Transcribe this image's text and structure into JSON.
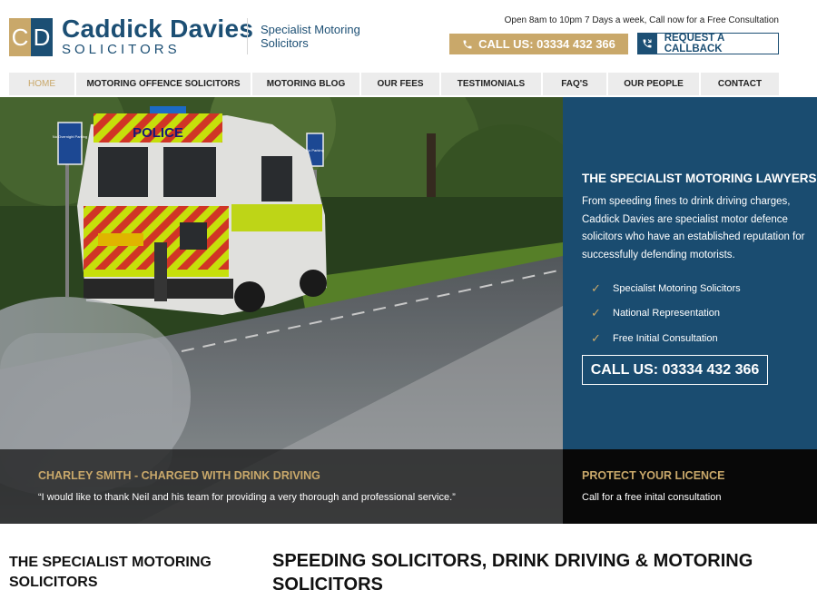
{
  "brand": {
    "logo_letters": [
      "C",
      "D"
    ],
    "name": "Caddick Davies",
    "sub": "SOLICITORS",
    "tagline": [
      "Specialist Motoring",
      "Solicitors"
    ]
  },
  "header": {
    "hours": "Open 8am to 10pm 7 Days a week, Call now for a Free Consultation",
    "call_label": "CALL US: 03334 432 366",
    "callback_label": "REQUEST A CALLBACK"
  },
  "nav": {
    "items": [
      {
        "label": "HOME",
        "active": true
      },
      {
        "label": "MOTORING OFFENCE SOLICITORS",
        "active": false
      },
      {
        "label": "MOTORING BLOG",
        "active": false
      },
      {
        "label": "OUR FEES",
        "active": false
      },
      {
        "label": "TESTIMONIALS",
        "active": false
      },
      {
        "label": "FAQ'S",
        "active": false
      },
      {
        "label": "OUR PEOPLE",
        "active": false
      },
      {
        "label": "CONTACT",
        "active": false
      }
    ]
  },
  "hero": {
    "photo": {
      "van_label": "POLICE",
      "sign_1": "No Overnight Parking",
      "sign_2": "No Parking"
    },
    "panel": {
      "title": "THE SPECIALIST MOTORING LAWYERS",
      "text": "From speeding fines to drink driving charges, Caddick Davies are specialist motor defence solicitors who have an established reputation for successfully defending motorists.",
      "list": [
        "Specialist Motoring Solicitors",
        "National Representation",
        "Free Initial Consultation"
      ],
      "call_label": "CALL US: 03334 432 366"
    },
    "testimonial": {
      "name": "CHARLEY SMITH - CHARGED WITH DRINK DRIVING",
      "quote": "“I would like to thank Neil and his team for providing a very thorough and professional service.”"
    },
    "protect": {
      "title": "PROTECT YOUR LICENCE",
      "sub": "Call for a free inital consultation"
    }
  },
  "content": {
    "left_heading": "THE SPECIALIST MOTORING SOLICITORS",
    "main_heading": "SPEEDING SOLICITORS, DRINK DRIVING & MOTORING SOLICITORS"
  },
  "colors": {
    "brand_blue": "#1c4f74",
    "brand_gold": "#c9a86a",
    "panel_blue": "#1a4c70"
  },
  "icons": {
    "phone": "phone-icon",
    "callback": "phone-callback-icon",
    "tick": "checkmark-icon"
  }
}
